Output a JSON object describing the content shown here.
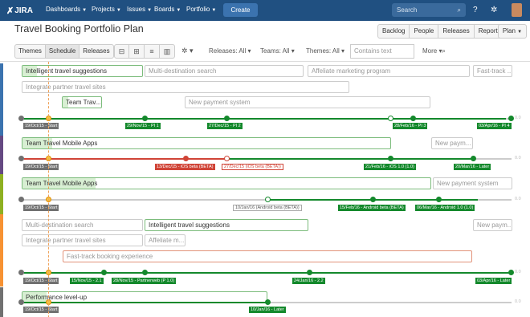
{
  "nav": {
    "logo": "JIRA",
    "menus": [
      "Dashboards",
      "Projects",
      "Issues",
      "Boards",
      "Portfolio"
    ],
    "create": "Create",
    "search_placeholder": "Search"
  },
  "page": {
    "title": "Travel Booking Portfolio Plan",
    "header_buttons": [
      "Backlog",
      "People",
      "Releases",
      "Reports"
    ],
    "plan_menu": "Plan"
  },
  "toolbar": {
    "views": [
      "Themes",
      "Schedule",
      "Releases"
    ],
    "active_view": "Schedule",
    "releases_filter": "Releases: All",
    "teams_filter": "Teams: All",
    "themes_filter": "Themes: All",
    "contains_placeholder": "Contains text",
    "more": "More"
  },
  "colors": {
    "nav_bg": "#205081",
    "create_bg": "#3b73af",
    "green": "#14892c",
    "red": "#d04437",
    "stripe_blue": "#3b73af",
    "stripe_purple": "#654982",
    "stripe_lime": "#8eb021",
    "stripe_orange": "#f79232",
    "stripe_grey": "#707070"
  },
  "streams": [
    {
      "bars": [
        {
          "label": "Intelligent travel suggestions",
          "active": true,
          "progress": 0.12
        },
        {
          "label": "Multi-destination search",
          "active": false
        },
        {
          "label": "Affeliate marketing program",
          "active": false
        },
        {
          "label": "Fast-track ...",
          "active": false
        },
        {
          "label": "Integrate partner travel sites",
          "active": false
        },
        {
          "label": "Team Trav...",
          "active": true,
          "progress": 0.15
        },
        {
          "label": "New payment system",
          "active": false
        }
      ],
      "releases": [
        "19/Oct/15 - Start",
        "29/Nov/15 - PI 1",
        "27/Dec/15 - PI 2",
        "28/Feb/16 - PI 3",
        "03/Apr/16 - PI 4"
      ]
    },
    {
      "bars": [
        {
          "label": "Team Travel Mobile Apps",
          "active": true,
          "progress": 0.08
        },
        {
          "label": "New paym...",
          "active": false
        }
      ],
      "releases": [
        "19/Oct/15 - Start",
        "13/Dec/15 - iOS beta (BETA)",
        "27/Dec/15 (iOS beta (BETA))",
        "21/Feb/16 - iOS 1.0 (1.0)",
        "20/Mar/16 - Later"
      ]
    },
    {
      "bars": [
        {
          "label": "Team Travel Mobile Apps",
          "active": true,
          "progress": 0.18
        },
        {
          "label": "New payment system",
          "active": false
        }
      ],
      "releases": [
        "19/Oct/15 - Start",
        "10/Jan/16 (Android beta (BETA))",
        "15/Feb/16 - Android beta (BETA)",
        "06/Mar/16 - Android 1.0 (1.0)"
      ]
    },
    {
      "bars": [
        {
          "label": "Multi-destination search",
          "active": false
        },
        {
          "label": "Intelligent travel suggestions",
          "active": true,
          "progress": 0.0
        },
        {
          "label": "New paym...",
          "active": false
        },
        {
          "label": "Integrate partner travel sites",
          "active": false
        },
        {
          "label": "Affeliate m...",
          "active": false
        },
        {
          "label": "Fast-track booking experience",
          "active": false
        }
      ],
      "releases": [
        "19/Oct/15 - Start",
        "15/Nov/15 - 2.1",
        "28/Nov/15 - Partnerweb (P 1.0)",
        "24/Jan/16 - 2.2",
        "03/Apr/16 - Later"
      ]
    },
    {
      "bars": [
        {
          "label": "Performance level-up",
          "active": true,
          "progress": 0.1
        }
      ],
      "releases": [
        "19/Oct/15 - Start",
        "10/Jan/16 - Later"
      ]
    }
  ],
  "tail_text": "0.0"
}
